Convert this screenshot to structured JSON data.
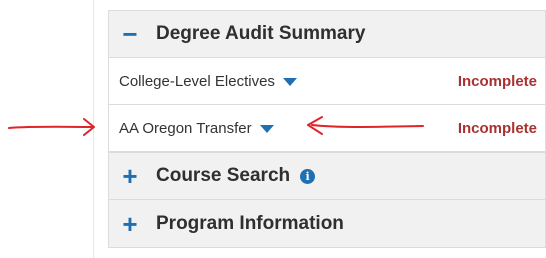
{
  "degree_audit": {
    "title": "Degree Audit Summary",
    "toggle": "−",
    "rows": [
      {
        "label": "College-Level Electives",
        "status": "Incomplete"
      },
      {
        "label": "AA Oregon Transfer",
        "status": "Incomplete"
      }
    ]
  },
  "course_search": {
    "title": "Course Search",
    "toggle": "+",
    "info": "i"
  },
  "program_information": {
    "title": "Program Information",
    "toggle": "+"
  },
  "colors": {
    "accent": "#1f6fb3",
    "status": "#a83232",
    "annotation": "#e0242a"
  }
}
